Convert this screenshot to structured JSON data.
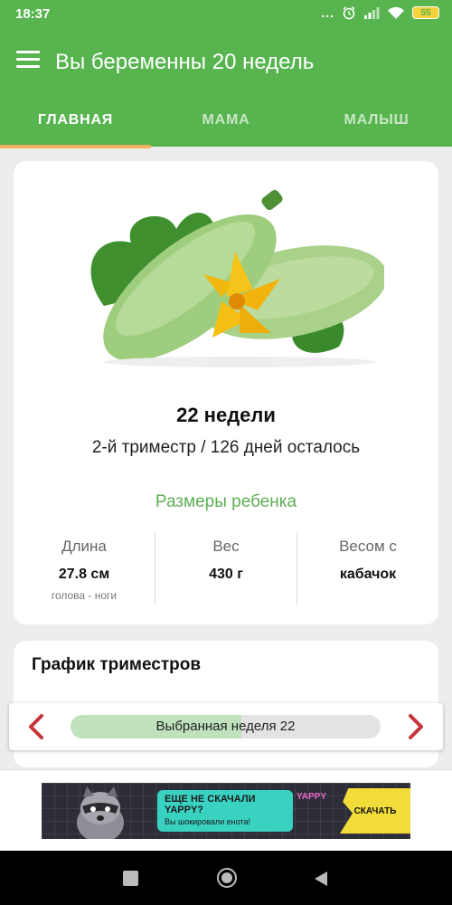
{
  "status_bar": {
    "time": "18:37",
    "battery": "55",
    "dots": "..."
  },
  "app_bar": {
    "title": "Вы беременны 20 недель"
  },
  "tabs": [
    {
      "label": "ГЛАВНАЯ",
      "active": true
    },
    {
      "label": "МАМА",
      "active": false
    },
    {
      "label": "МАЛЫШ",
      "active": false
    }
  ],
  "week_card": {
    "image": "zucchini-with-flower",
    "week_title": "22 недели",
    "trimester_info": "2-й триместр / 126 дней осталось",
    "sizes_heading": "Размеры ребенка",
    "stats": [
      {
        "label": "Длина",
        "value": "27.8 см",
        "sub": "голова - ноги"
      },
      {
        "label": "Вес",
        "value": "430 г",
        "sub": ""
      },
      {
        "label": "Весом с",
        "value": "кабачок",
        "sub": ""
      }
    ]
  },
  "trimester_graph": {
    "title": "График триместров"
  },
  "week_selector": {
    "label": "Выбранная неделя 22",
    "progress_fraction": 0.55
  },
  "ad": {
    "headline": "ЕЩЕ НЕ СКАЧАЛИ YAPPY?",
    "subline": "Вы шокировали енота!",
    "brand": "YAPPY",
    "cta": "СКАЧАТЬ"
  },
  "colors": {
    "primary": "#57b44f",
    "tab_indicator": "#f2b063",
    "accent_green_text": "#5cb054",
    "arrow_red": "#c8333a"
  }
}
